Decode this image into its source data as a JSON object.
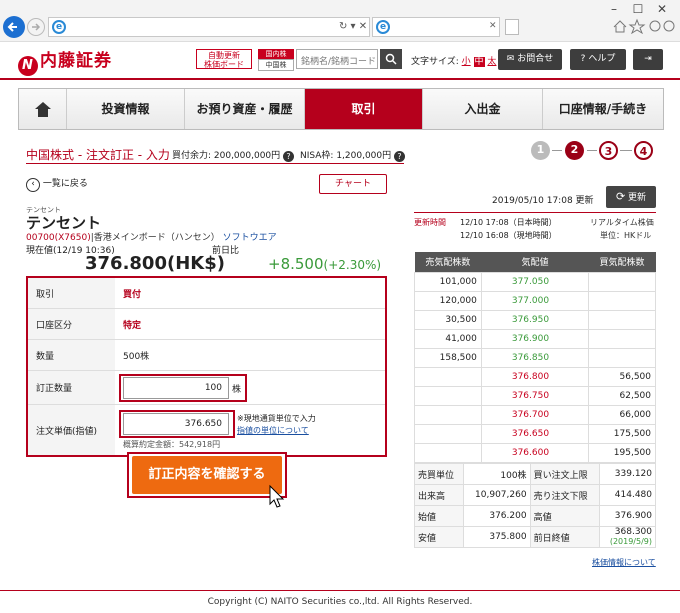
{
  "browser": {
    "minimize": "–",
    "maximize": "☐",
    "close": "✕",
    "back_icon": "arrow-left-icon",
    "forward_icon": "arrow-right-icon",
    "addr_controls": "↻ ▾ ✕"
  },
  "header": {
    "logo_text": "内藤証券",
    "logo_mark": "N",
    "auto_update_line1": "自動更新",
    "auto_update_line2": "株価ボード",
    "domestic_line1": "国内株",
    "domestic_line2": "中国株",
    "search_placeholder": "銘柄名/銘柄コード",
    "font_size_label": "文字サイズ:",
    "font_small": "小",
    "font_mid": "中",
    "font_large": "太",
    "contact_label": "お問合せ",
    "help_label": "ヘルプ"
  },
  "nav": {
    "home_icon": "home-icon",
    "items": [
      "投資情報",
      "お預り資産・履歴",
      "取引",
      "入出金",
      "口座情報/手続き"
    ],
    "active": "取引"
  },
  "title": {
    "text": "中国株式 - 注文訂正 - 入力",
    "buying_power": "買付余力: 200,000,000円",
    "nisa": "NISA枠: 1,200,000円"
  },
  "steps": [
    "1",
    "2",
    "3",
    "4"
  ],
  "current_step": "2",
  "links": {
    "back_list": "一覧に戻る",
    "chart": "チャート"
  },
  "update": {
    "time": "2019/05/10 17:08 更新",
    "button": "更新"
  },
  "stock": {
    "kana": "テンセント",
    "name": "テンセント",
    "code": "00700(X7650)",
    "market": "香港メインボード（ハンセン）",
    "sector": "ソフトウエア",
    "price_label": "現在値(12/19 10:36)",
    "change_label": "前日比",
    "price": "376.800(HK$)",
    "change": "+8.500",
    "change_pct": "(+2.30%)"
  },
  "order": {
    "rows": [
      {
        "label": "取引",
        "value": "買付"
      },
      {
        "label": "口座区分",
        "value": "特定"
      },
      {
        "label": "数量",
        "value": "500株"
      }
    ],
    "qty_label": "訂正数量",
    "qty_value": "100",
    "qty_unit": "株",
    "price_label": "注文単価(指値)",
    "price_value": "376.650",
    "price_note": "※現地通貨単位で入力",
    "price_link": "指値の単位について",
    "estimate": "概算約定金額：542,918円"
  },
  "confirm_button": "訂正内容を確認する",
  "board": {
    "update_label": "更新時間",
    "time_jp": "12/10 17:08（日本時間）",
    "time_local": "12/10 16:08（現地時間）",
    "realtime": "リアルタイム株価",
    "unit": "単位：HKドル",
    "headers": [
      "売気配株数",
      "気配値",
      "買気配株数"
    ],
    "asks": [
      {
        "qty": "101,000",
        "price": "377.050"
      },
      {
        "qty": "120,000",
        "price": "377.000"
      },
      {
        "qty": "30,500",
        "price": "376.950"
      },
      {
        "qty": "41,000",
        "price": "376.900"
      },
      {
        "qty": "158,500",
        "price": "376.850"
      }
    ],
    "bids": [
      {
        "price": "376.800",
        "qty": "56,500"
      },
      {
        "price": "376.750",
        "qty": "62,500"
      },
      {
        "price": "376.700",
        "qty": "66,000"
      },
      {
        "price": "376.650",
        "qty": "175,500"
      },
      {
        "price": "376.600",
        "qty": "195,500"
      }
    ]
  },
  "stats": [
    {
      "k1": "売買単位",
      "v1": "100株",
      "k2": "買い注文上限",
      "v2": "339.120"
    },
    {
      "k1": "出来高",
      "v1": "10,907,260",
      "k2": "売り注文下限",
      "v2": "414.480"
    },
    {
      "k1": "始値",
      "v1": "376.200",
      "k2": "高値",
      "v2": "376.900"
    },
    {
      "k1": "安値",
      "v1": "375.800",
      "k2": "前日終値",
      "v2": "368.300",
      "v2b": "(2019/5/9)"
    }
  ],
  "stock_info_link": "株価情報について",
  "footer": "Copyright (C) NAITO Securities co.,ltd. All Rights Reserved."
}
